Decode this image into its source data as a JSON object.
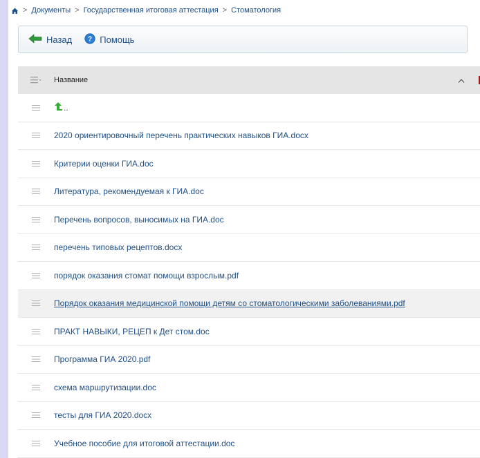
{
  "breadcrumb": {
    "items": [
      "Документы",
      "Государственная итоговая аттестация",
      "Стоматология"
    ],
    "separator": ">"
  },
  "toolbar": {
    "back_label": "Назад",
    "help_label": "Помощь"
  },
  "table": {
    "header": "Название",
    "up_label": "..",
    "rows": [
      "2020 ориентировочный перечень практических навыков ГИА.docx",
      "Критерии оценки ГИА.doc",
      "Литература, рекомендуемая к ГИА.doc",
      "Перечень вопросов, выносимых на ГИА.doc",
      "перечень типовых рецептов.docx",
      "порядок оказания стомат помощи взрослым.pdf",
      "Порядок оказания медицинской помощи детям со стоматологическими заболеваниями.pdf",
      "ПРАКТ НАВЫКИ, РЕЦЕП к Дет стом.doc",
      "Программа ГИА 2020.pdf",
      "схема маршрутизации.doc",
      "тесты для ГИА 2020.docx",
      "Учебное пособие для итоговой аттестации.doc"
    ]
  },
  "colors": {
    "link": "#1f4f86",
    "back_arrow": "#2e9a3a",
    "help_circle": "#2c7fd4",
    "up_arrow": "#2fae2f",
    "page_bg": "#d9d9f6"
  }
}
